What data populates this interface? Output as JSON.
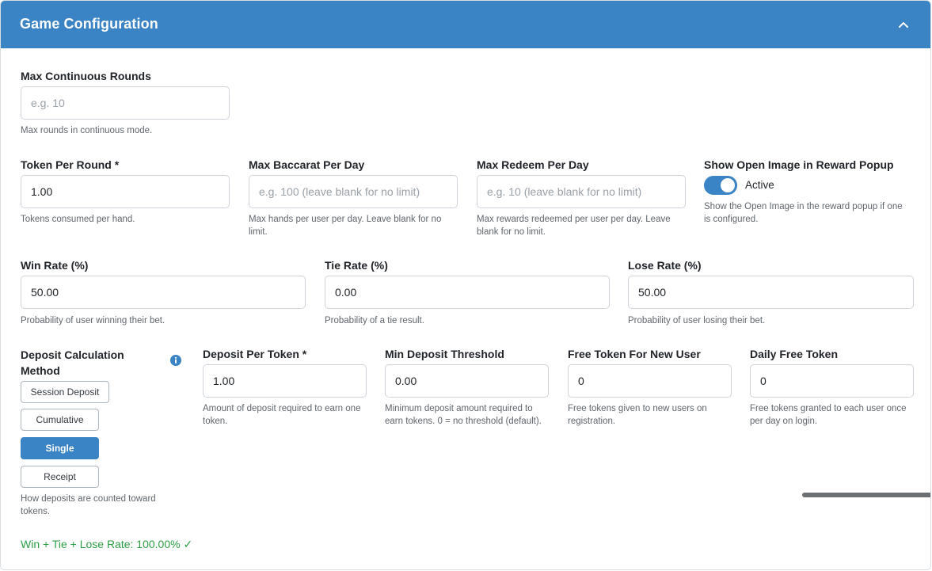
{
  "header": {
    "title": "Game Configuration",
    "collapse_icon": "chevron-up-icon"
  },
  "fields": {
    "max_continuous_rounds": {
      "label": "Max Continuous Rounds",
      "placeholder": "e.g. 10",
      "value": "",
      "help": "Max rounds in continuous mode."
    },
    "token_per_round": {
      "label": "Token Per Round *",
      "value": "1.00",
      "help": "Tokens consumed per hand."
    },
    "max_baccarat_per_day": {
      "label": "Max Baccarat Per Day",
      "placeholder": "e.g. 100 (leave blank for no limit)",
      "value": "",
      "help": "Max hands per user per day. Leave blank for no limit."
    },
    "max_redeem_per_day": {
      "label": "Max Redeem Per Day",
      "placeholder": "e.g. 10 (leave blank for no limit)",
      "value": "",
      "help": "Max rewards redeemed per user per day. Leave blank for no limit."
    },
    "show_open_image": {
      "label": "Show Open Image in Reward Popup",
      "state_label": "Active",
      "enabled": true,
      "help": "Show the Open Image in the reward popup if one is configured."
    },
    "win_rate": {
      "label": "Win Rate (%)",
      "value": "50.00",
      "help": "Probability of user winning their bet."
    },
    "tie_rate": {
      "label": "Tie Rate (%)",
      "value": "0.00",
      "help": "Probability of a tie result."
    },
    "lose_rate": {
      "label": "Lose Rate (%)",
      "value": "50.00",
      "help": "Probability of user losing their bet."
    },
    "deposit_method": {
      "label": "Deposit Calculation Method",
      "info_icon": "info-icon",
      "options": [
        "Session Deposit",
        "Cumulative",
        "Single",
        "Receipt"
      ],
      "selected": "Single",
      "help": "How deposits are counted toward tokens."
    },
    "deposit_per_token": {
      "label": "Deposit Per Token *",
      "value": "1.00",
      "help": "Amount of deposit required to earn one token."
    },
    "min_deposit_threshold": {
      "label": "Min Deposit Threshold",
      "value": "0.00",
      "help": "Minimum deposit amount required to earn tokens. 0 = no threshold (default)."
    },
    "free_token_new_user": {
      "label": "Free Token For New User",
      "value": "0",
      "help": "Free tokens given to new users on registration."
    },
    "daily_free_token": {
      "label": "Daily Free Token",
      "value": "0",
      "help": "Free tokens granted to each user once per day on login."
    }
  },
  "rate_total": "Win + Tie + Lose Rate: 100.00% ✓",
  "colors": {
    "primary": "#3a83c4",
    "success": "#2e9e45",
    "border": "#ced4da"
  }
}
